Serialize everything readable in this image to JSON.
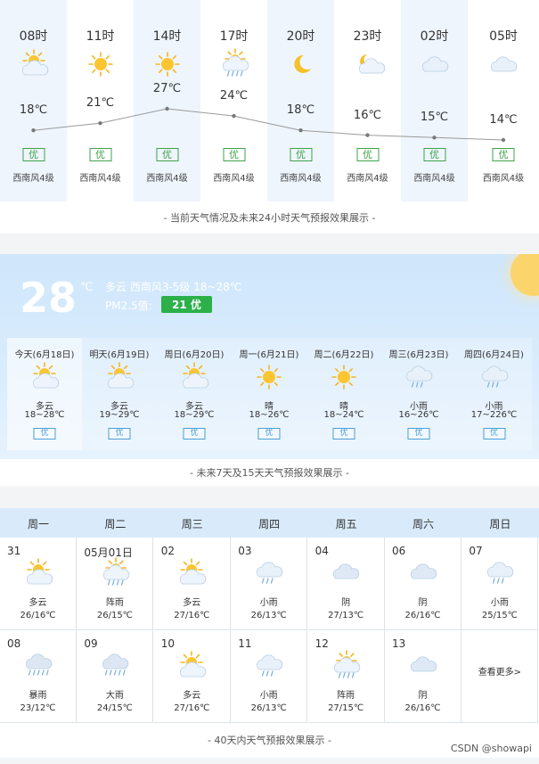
{
  "hourly": {
    "items": [
      {
        "time": "08时",
        "icon": "partly-cloudy-sun-icon",
        "temp": "18℃",
        "t": 18,
        "aqi": "优",
        "wind": "西南风4级"
      },
      {
        "time": "11时",
        "icon": "sunny-icon",
        "temp": "21℃",
        "t": 21,
        "aqi": "优",
        "wind": "西南风4级"
      },
      {
        "time": "14时",
        "icon": "sunny-icon",
        "temp": "27℃",
        "t": 27,
        "aqi": "优",
        "wind": "西南风4级"
      },
      {
        "time": "17时",
        "icon": "sun-shower-icon",
        "temp": "24℃",
        "t": 24,
        "aqi": "优",
        "wind": "西南风4级"
      },
      {
        "time": "20时",
        "icon": "moon-icon",
        "temp": "18℃",
        "t": 18,
        "aqi": "优",
        "wind": "西南风4级"
      },
      {
        "time": "23时",
        "icon": "moon-cloudy-icon",
        "temp": "16℃",
        "t": 16,
        "aqi": "优",
        "wind": "西南风4级"
      },
      {
        "time": "02时",
        "icon": "cloudy-icon",
        "temp": "15℃",
        "t": 15,
        "aqi": "优",
        "wind": "西南风4级"
      },
      {
        "time": "05时",
        "icon": "cloudy-icon",
        "temp": "14℃",
        "t": 14,
        "aqi": "优",
        "wind": "西南风4级"
      }
    ],
    "caption": "- 当前天气情况及未来24小时天气预报效果展示 -"
  },
  "current": {
    "temp": "28",
    "unit": "℃",
    "info": "多云  西南风3-5级  18~28℃",
    "pm_label": "PM2.5值:",
    "pm_value": "21 优"
  },
  "week": {
    "days": [
      {
        "name": "今天(6月18日)",
        "icon": "partly-cloudy-sun-icon",
        "cond": "多云",
        "range": "18~28℃",
        "aqi": "优"
      },
      {
        "name": "明天(6月19日)",
        "icon": "partly-cloudy-sun-icon",
        "cond": "多云",
        "range": "19~29℃",
        "aqi": "优"
      },
      {
        "name": "周日(6月20日)",
        "icon": "partly-cloudy-sun-icon",
        "cond": "多云",
        "range": "18~29℃",
        "aqi": "优"
      },
      {
        "name": "周一(6月21日)",
        "icon": "sunny-icon",
        "cond": "晴",
        "range": "18~26℃",
        "aqi": "优"
      },
      {
        "name": "周二(6月22日)",
        "icon": "sunny-icon",
        "cond": "晴",
        "range": "18~24℃",
        "aqi": "优"
      },
      {
        "name": "周三(6月23日)",
        "icon": "light-rain-icon",
        "cond": "小雨",
        "range": "16~26℃",
        "aqi": "优"
      },
      {
        "name": "周四(6月24日)",
        "icon": "light-rain-icon",
        "cond": "小雨",
        "range": "17~226℃",
        "aqi": "优"
      }
    ],
    "caption": "- 未来7天及15天天气预报效果展示 -"
  },
  "month": {
    "weekdays": [
      "周一",
      "周二",
      "周三",
      "周四",
      "周五",
      "周六",
      "周日"
    ],
    "row1": [
      {
        "date": "31",
        "icon": "partly-cloudy-sun-icon",
        "cond": "多云",
        "range": "26/16℃"
      },
      {
        "date": "05月01日",
        "icon": "sun-shower-icon",
        "cond": "阵雨",
        "range": "26/15℃"
      },
      {
        "date": "02",
        "icon": "partly-cloudy-sun-icon",
        "cond": "多云",
        "range": "27/16℃"
      },
      {
        "date": "03",
        "icon": "light-rain-icon",
        "cond": "小雨",
        "range": "26/13℃"
      },
      {
        "date": "04",
        "icon": "overcast-icon",
        "cond": "阴",
        "range": "27/13℃"
      },
      {
        "date": "06",
        "icon": "overcast-icon",
        "cond": "阴",
        "range": "26/16℃"
      },
      {
        "date": "07",
        "icon": "light-rain-icon",
        "cond": "小雨",
        "range": "25/15℃"
      }
    ],
    "row2": [
      {
        "date": "08",
        "icon": "heavy-rain-icon",
        "cond": "暴雨",
        "range": "23/12℃"
      },
      {
        "date": "09",
        "icon": "heavy-rain-icon",
        "cond": "大雨",
        "range": "24/15℃"
      },
      {
        "date": "10",
        "icon": "partly-cloudy-sun-icon",
        "cond": "多云",
        "range": "27/16℃"
      },
      {
        "date": "11",
        "icon": "light-rain-icon",
        "cond": "小雨",
        "range": "26/13℃"
      },
      {
        "date": "12",
        "icon": "sun-shower-icon",
        "cond": "阵雨",
        "range": "27/15℃"
      },
      {
        "date": "13",
        "icon": "overcast-icon",
        "cond": "阴",
        "range": "26/16℃"
      }
    ],
    "more": "查看更多>",
    "caption": "- 40天内天气预报效果展示 -"
  },
  "watermark": "CSDN @showapi"
}
